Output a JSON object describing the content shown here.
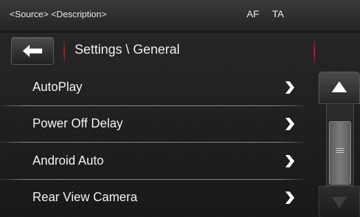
{
  "status_bar": {
    "source_description": "<Source> <Description>",
    "af": "AF",
    "ta": "TA"
  },
  "header": {
    "back_icon": "left-arrow-icon",
    "title": "Settings \\ General"
  },
  "menu": {
    "items": [
      {
        "label": "AutoPlay",
        "icon": "chevron-right-icon"
      },
      {
        "label": "Power Off Delay",
        "icon": "chevron-right-icon"
      },
      {
        "label": "Android Auto",
        "icon": "chevron-right-icon"
      },
      {
        "label": "Rear View Camera",
        "icon": "chevron-right-icon"
      }
    ]
  },
  "scrollbar": {
    "up_icon": "triangle-up-icon",
    "down_icon": "triangle-down-icon",
    "down_enabled": false
  },
  "colors": {
    "accent_red": "#c21d1d",
    "text": "#f4f4f4",
    "background": "#1c1c1c"
  }
}
